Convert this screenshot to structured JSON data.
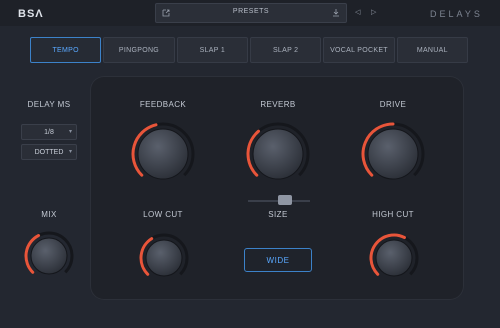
{
  "header": {
    "logo": "BSΛ",
    "preset_label": "PRESETS",
    "brand": "DELAYS"
  },
  "tabs": [
    {
      "label": "TEMPO",
      "active": true
    },
    {
      "label": "PINGPONG",
      "active": false
    },
    {
      "label": "SLAP 1",
      "active": false
    },
    {
      "label": "SLAP 2",
      "active": false
    },
    {
      "label": "VOCAL POCKET",
      "active": false
    },
    {
      "label": "MANUAL",
      "active": false
    }
  ],
  "delay": {
    "title": "DELAY MS",
    "division": "1/8",
    "mode": "DOTTED"
  },
  "knobs": {
    "feedback": {
      "label": "FEEDBACK",
      "value": 0.45
    },
    "reverb": {
      "label": "REVERB",
      "value": 0.35
    },
    "drive": {
      "label": "DRIVE",
      "value": 0.5
    },
    "mix": {
      "label": "MIX",
      "value": 0.4
    },
    "low_cut": {
      "label": "LOW CUT",
      "value": 0.38
    },
    "high_cut": {
      "label": "HIGH CUT",
      "value": 0.6
    }
  },
  "size": {
    "label": "SIZE",
    "value": 0.55
  },
  "wide_label": "WIDE",
  "colors": {
    "accent": "#e8553a",
    "active_blue": "#3c82c9"
  }
}
